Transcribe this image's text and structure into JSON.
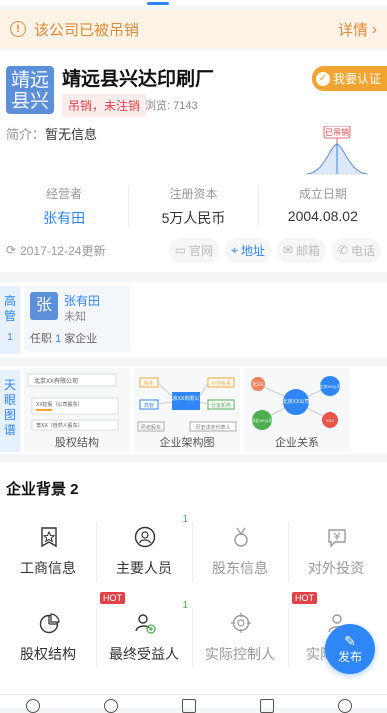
{
  "warning": {
    "text": "该公司已被吊销",
    "detail": "详情"
  },
  "company": {
    "logo_line1": "靖远",
    "logo_line2": "县兴",
    "name": "靖远县兴达印刷厂",
    "status": "吊销，未注销",
    "views": "浏览: 7143",
    "certify": "我要认证",
    "intro_label": "简介：",
    "intro_value": "暂无信息",
    "chart_label": "已吊销"
  },
  "stats": [
    {
      "label": "经营者",
      "value": "张有田"
    },
    {
      "label": "注册资本",
      "value": "5万人民币"
    },
    {
      "label": "成立日期",
      "value": "2004.08.02"
    }
  ],
  "updated": "2017-12-24更新",
  "chips": [
    "官网",
    "地址",
    "邮箱",
    "电话"
  ],
  "executives": {
    "label": "高管",
    "count": "1",
    "person": {
      "avatar": "张",
      "name": "张有田",
      "role": "未知",
      "companies_prefix": "任职",
      "companies_count": "1",
      "companies_suffix": "家企业"
    }
  },
  "graphs": {
    "label": "天眼图谱",
    "items": [
      {
        "caption": "股权结构",
        "t1": "北京XX有限公司",
        "t2": "XX控股（公司股东）",
        "t3": "李XX（自然人股东）"
      },
      {
        "caption": "企业架构图",
        "t1": "股东",
        "t2": "对外投资",
        "t3": "北京XX有限公司",
        "t4": "高管",
        "t5": "分支机构",
        "t6": "历史股东",
        "t7": "历史法定代表人"
      },
      {
        "caption": "企业关系",
        "t1": "北京XX公司",
        "t2": "张XX",
        "t3": "河北XX公司",
        "t4": "北京XX公司",
        "t5": "XXX"
      }
    ]
  },
  "background": {
    "title": "企业背景 2",
    "cells": [
      {
        "label": "工商信息",
        "num": "",
        "hot": ""
      },
      {
        "label": "主要人员",
        "num": "1",
        "hot": ""
      },
      {
        "label": "股东信息",
        "num": "",
        "hot": ""
      },
      {
        "label": "对外投资",
        "num": "",
        "hot": ""
      },
      {
        "label": "股权结构",
        "num": "",
        "hot": ""
      },
      {
        "label": "最终受益人",
        "num": "1",
        "hot": "HOT"
      },
      {
        "label": "实际控制人",
        "num": "",
        "hot": ""
      },
      {
        "label": "实际",
        "num": "",
        "hot": "HOT"
      }
    ]
  },
  "fab": "发布"
}
